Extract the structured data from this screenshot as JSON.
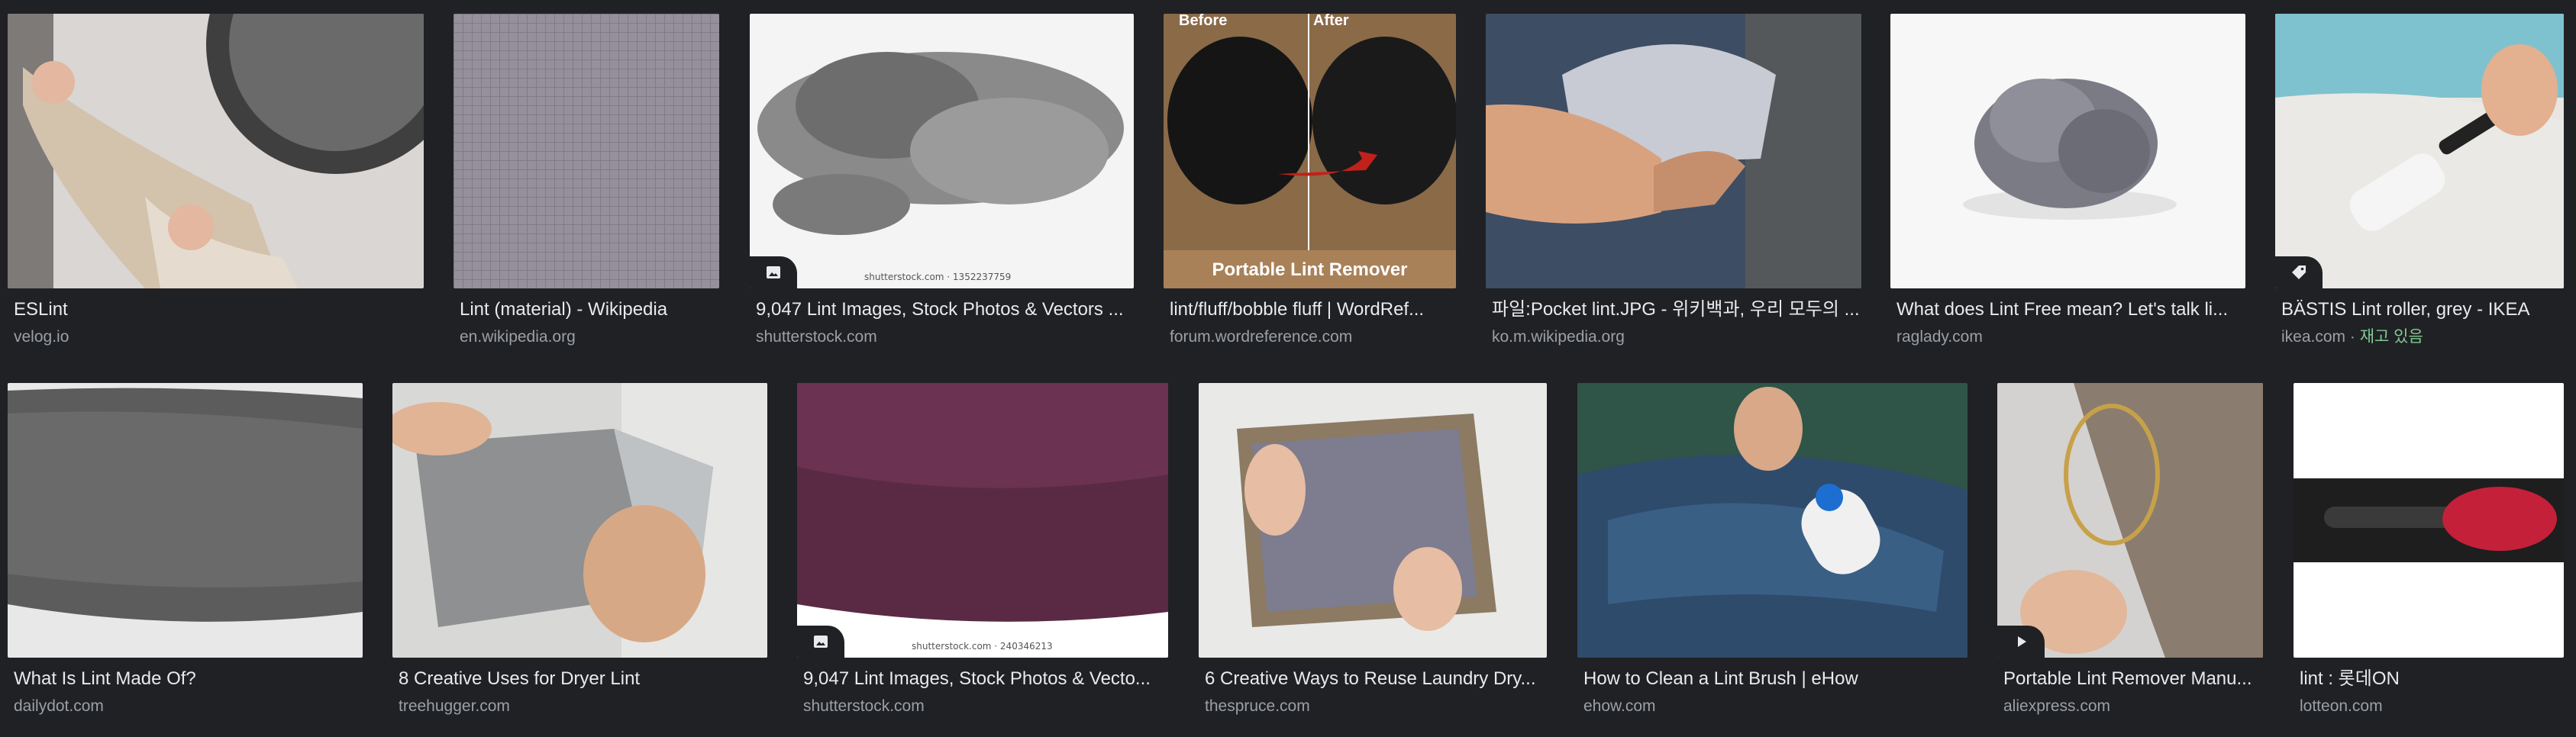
{
  "results": [
    {
      "title": "ESLint",
      "source": "velog.io"
    },
    {
      "title": "Lint (material) - Wikipedia",
      "source": "en.wikipedia.org"
    },
    {
      "title": "9,047 Lint Images, Stock Photos & Vectors ...",
      "source": "shutterstock.com",
      "watermark": "shutterstock.com · 1352237759"
    },
    {
      "title": "lint/fluff/bobble fluff | WordRef...",
      "source": "forum.wordreference.com",
      "overlay": {
        "before": "Before",
        "after": "After",
        "caption": "Portable Lint Remover"
      }
    },
    {
      "title": "파일:Pocket lint.JPG - 위키백과, 우리 모두의 ...",
      "source": "ko.m.wikipedia.org"
    },
    {
      "title": "What does Lint Free mean? Let's talk li...",
      "source": "raglady.com"
    },
    {
      "title": "BÄSTIS Lint roller, grey - IKEA",
      "source": "ikea.com",
      "stock": "재고 있음",
      "stock_sep": " · "
    },
    {
      "title": "What Is Lint Made Of?",
      "source": "dailydot.com"
    },
    {
      "title": "8 Creative Uses for Dryer Lint",
      "source": "treehugger.com"
    },
    {
      "title": "9,047 Lint Images, Stock Photos & Vecto...",
      "source": "shutterstock.com",
      "watermark": "shutterstock.com · 240346213"
    },
    {
      "title": "6 Creative Ways to Reuse Laundry Dry...",
      "source": "thespruce.com"
    },
    {
      "title": "How to Clean a Lint Brush | eHow",
      "source": "ehow.com"
    },
    {
      "title": "Portable Lint Remover Manu...",
      "source": "aliexpress.com"
    },
    {
      "title": "lint : 롯데ON",
      "source": "lotteon.com"
    }
  ],
  "badge_icons": {
    "image": "image-icon",
    "tag": "tag-icon",
    "play": "play-icon"
  }
}
